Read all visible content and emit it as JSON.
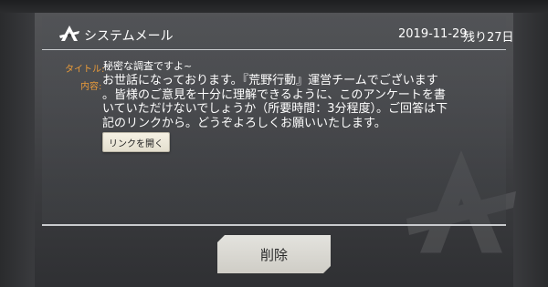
{
  "header": {
    "title": "システムメール",
    "date": "2019-11-29",
    "days_left": "残り27日"
  },
  "mail": {
    "subject_label": "タイトル:",
    "subject": "秘密な調査ですよ~",
    "content_label": "内容:",
    "body_lines": [
      "お世話になっております。『荒野行動』運営チームでございます",
      "。皆様のご意見を十分に理解できるように、このアンケートを書",
      "いていただけないでしょうか（所要時間：3分程度）。ご回答は下",
      "記のリンクから。どうぞよろしくお願いいたします。"
    ],
    "link_button_label": "リンクを開く"
  },
  "footer": {
    "delete_label": "削除"
  },
  "icons": {
    "logo": "game-emblem-icon"
  },
  "colors": {
    "label_accent": "#e89a3a",
    "text": "#ffffff",
    "button_bg": "#e4e3de"
  }
}
